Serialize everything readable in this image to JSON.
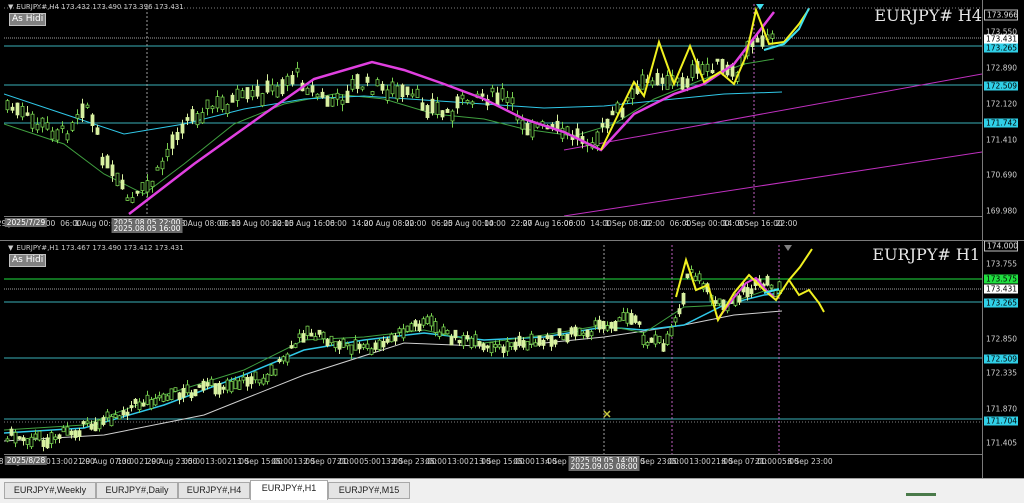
{
  "chart_h4": {
    "header": "EURJPY#,H4  173.432 173.490 173.396 173.431",
    "as_hide": "As Hidi",
    "title": "EURJPY# H4",
    "price_labels": [
      "173.550",
      "172.890",
      "172.120",
      "171.410",
      "170.690",
      "169.980"
    ],
    "price_boxes": [
      {
        "text": "173.966",
        "kind": "top"
      },
      {
        "text": "173.431",
        "kind": "current"
      },
      {
        "text": "173.265",
        "kind": "cyan"
      },
      {
        "text": "172.509",
        "kind": "cyan"
      },
      {
        "text": "171.742",
        "kind": "cyan"
      }
    ],
    "time_labels": [
      "29 Jul 2025",
      "22:00",
      "06:00",
      "1 Aug 00:00",
      "06:00",
      "14:00",
      "22:00",
      "8 Aug 08:00",
      "06:00",
      "13 Aug 00:00",
      "22:00",
      "15 Aug 16:00",
      "06:00",
      "14:00",
      "20 Aug 08:00",
      "22:00",
      "06:00",
      "25 Aug 00:00",
      "14:00",
      "22:00",
      "27 Aug 16:00",
      "06:00",
      "14:00",
      "1 Sep 08:00",
      "22:00",
      "06:00",
      "4 Sep 00:00",
      "14:00",
      "8 Sep 16:00",
      "22:00"
    ],
    "time_tags": [
      "2025/7/29",
      "2025.08.05 22:00",
      "2025.08.05 16:00"
    ]
  },
  "chart_h1": {
    "header": "EURJPY#,H1  173.467 173.490 173.412 173.431",
    "as_hide": "As Hidi",
    "title": "EURJPY# H1",
    "price_labels": [
      "173.755",
      "172.850",
      "172.335",
      "171.870",
      "171.405"
    ],
    "price_boxes": [
      {
        "text": "174.000",
        "kind": "top"
      },
      {
        "text": "173.575",
        "kind": "green"
      },
      {
        "text": "173.431",
        "kind": "current"
      },
      {
        "text": "173.265",
        "kind": "cyan"
      },
      {
        "text": "172.509",
        "kind": "cyan"
      },
      {
        "text": "171.704",
        "kind": "cyan"
      }
    ],
    "time_labels": [
      "28 Aug 2025",
      "05:00",
      "13:00",
      "21:00",
      "29 Aug 07:00",
      "13:00",
      "21:00",
      "29 Aug 23:00",
      "05:00",
      "13:00",
      "21:00",
      "1 Sep 15:00",
      "05:00",
      "13:00",
      "2 Sep 07:00",
      "21:00",
      "05:00",
      "13:00",
      "2 Sep 23:00",
      "05:00",
      "13:00",
      "21:00",
      "3 Sep 15:00",
      "05:00",
      "13:00",
      "4 Sep 07:00",
      "21:00",
      "05:00",
      "13:00",
      "4 Sep 23:00",
      "05:00",
      "13:00",
      "21:00",
      "8 Sep 07:00",
      "21:00",
      "05:00",
      "8 Sep 23:00"
    ],
    "time_tags": [
      "2025/8/28",
      "2025.09.05 14:00",
      "2025.09.05 08:00"
    ]
  },
  "tabs": [
    {
      "label": "EURJPY#,Weekly",
      "active": false
    },
    {
      "label": "EURJPY#,Daily",
      "active": false
    },
    {
      "label": "EURJPY#,H4",
      "active": false
    },
    {
      "label": "EURJPY#,H1",
      "active": true
    },
    {
      "label": "EURJPY#,M15",
      "active": false
    }
  ],
  "colors": {
    "background": "#000000",
    "bull_candle": "#d8f0a0",
    "bear_candle": "#78d050",
    "zigzag_h4": "#e040e0",
    "forecast": "#f0f020",
    "projection": "#40e0f0",
    "level_line": "#3ab0b8",
    "ma_slow": "#d0d0d0",
    "ma_cyan": "#30c8e8",
    "ma_green": "#40a040",
    "current_price_box": "#ffffff",
    "level_box": "#30d0e8",
    "green_box": "#20e040"
  }
}
